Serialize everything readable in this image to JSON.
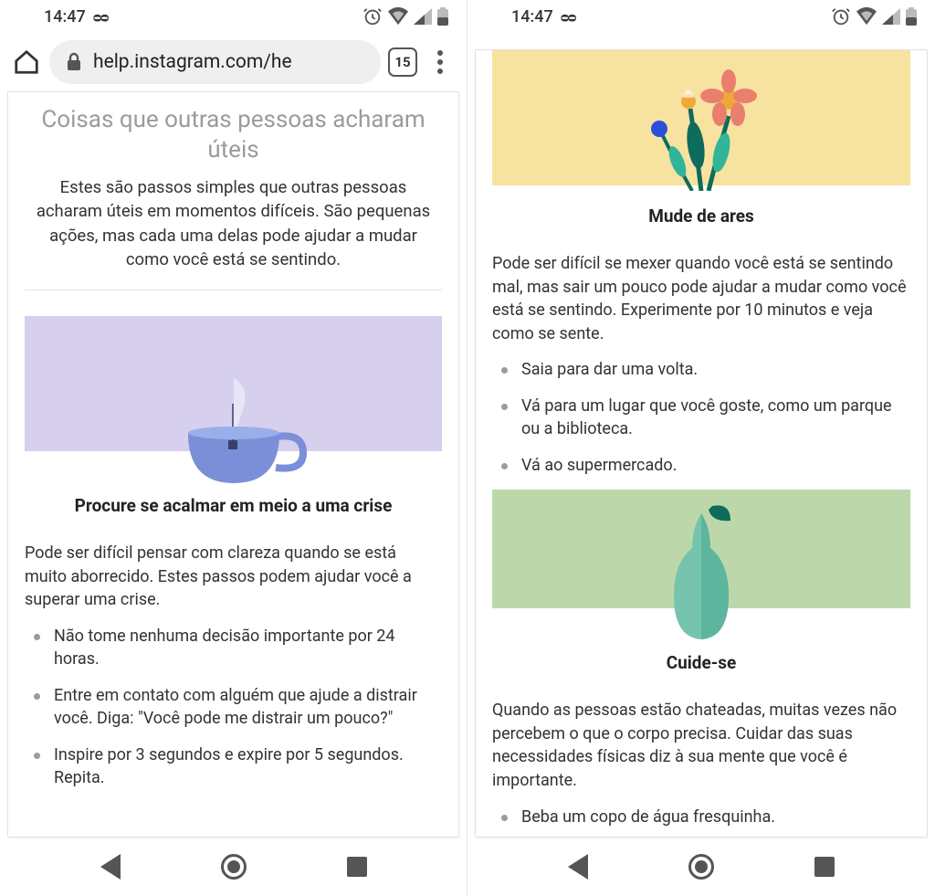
{
  "status": {
    "time": "14:47",
    "voicemail_glyph": "ᴑᴑ"
  },
  "browser": {
    "url_display": "help.instagram.com/he",
    "tab_count": "15"
  },
  "left": {
    "hero_title": "Coisas que outras pessoas acharam úteis",
    "hero_sub": "Estes são passos simples que outras pessoas acharam úteis em momentos difíceis. São pequenas ações, mas cada uma delas pode ajudar a mudar como você está se sentindo.",
    "section1": {
      "title": "Procure se acalmar em meio a uma crise",
      "body": "Pode ser difícil pensar com clareza quando se está muito aborrecido. Estes passos podem ajudar você a superar uma crise.",
      "tips": [
        "Não tome nenhuma decisão importante por 24 horas.",
        "Entre em contato com alguém que ajude a distrair você. Diga: \"Você pode me distrair um pouco?\"",
        "Inspire por 3 segundos e expire por 5 segundos. Repita."
      ]
    }
  },
  "right": {
    "section2": {
      "title": "Mude de ares",
      "body": "Pode ser difícil se mexer quando você está se sentindo mal, mas sair um pouco pode ajudar a mudar como você está se sentindo. Experimente por 10 minutos e veja como se sente.",
      "tips": [
        "Saia para dar uma volta.",
        "Vá para um lugar que você goste, como um parque ou a biblioteca.",
        "Vá ao supermercado."
      ]
    },
    "section3": {
      "title": "Cuide-se",
      "body": "Quando as pessoas estão chateadas, muitas vezes não percebem o que o corpo precisa. Cuidar das suas necessidades físicas diz à sua mente que você é importante.",
      "tips": [
        "Beba um copo de água fresquinha."
      ]
    }
  }
}
